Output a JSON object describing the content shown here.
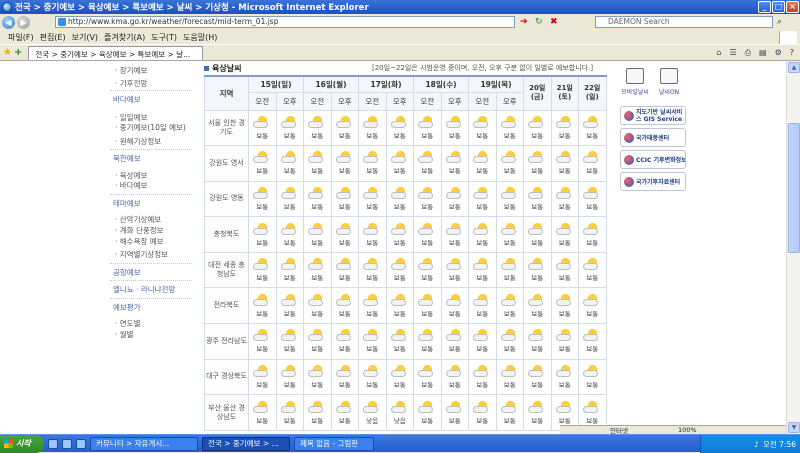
{
  "window": {
    "title": "전국 > 중기예보 > 육상예보 > 특보예보 > 날씨 > 기상청 - Microsoft Internet Explorer"
  },
  "browser": {
    "address": "http://www.kma.go.kr/weather/forecast/mid-term_01.jsp",
    "search_placeholder": "DAEMON Search",
    "menu": [
      "파일(F)",
      "편집(E)",
      "보기(V)",
      "즐겨찾기(A)",
      "도구(T)",
      "도움말(H)"
    ],
    "tab_title": "전국 > 중기예보 > 육상예보 > 특보예보 > 날..."
  },
  "leftnav": {
    "items": [
      {
        "label": "· 장기예보",
        "type": "sub"
      },
      {
        "label": "· 기후전망",
        "type": "sub"
      },
      {
        "label": "바다예보",
        "type": "cat"
      },
      {
        "label": "· 일일예보",
        "type": "sub"
      },
      {
        "label": "· 중기예보(10일 예보)",
        "type": "sub"
      },
      {
        "label": "· 원해기상정보",
        "type": "sub"
      },
      {
        "label": "북한예보",
        "type": "cat"
      },
      {
        "label": "· 육상예보",
        "type": "sub"
      },
      {
        "label": "· 바다예보",
        "type": "sub"
      },
      {
        "label": "테마예보",
        "type": "cat"
      },
      {
        "label": "· 산악기상예보",
        "type": "sub"
      },
      {
        "label": "· 계화 단풍정보",
        "type": "sub"
      },
      {
        "label": "· 해수욕장 예보",
        "type": "sub"
      },
      {
        "label": "· 지역별기상정보",
        "type": "sub"
      },
      {
        "label": "공항예보",
        "type": "cat"
      },
      {
        "label": "엘니뇨 · 라니냐전망",
        "type": "cat"
      },
      {
        "label": "예보평가",
        "type": "cat"
      },
      {
        "label": "· 연도별",
        "type": "sub"
      },
      {
        "label": "· 월별",
        "type": "sub"
      }
    ]
  },
  "forecast": {
    "heading": "육상날씨",
    "note": "[20일~22일은 시범운영 중이며, 오전, 오후 구분 없이 일별로 예보합니다.]",
    "region_header": "지역",
    "dates": [
      {
        "label": "15일(일)",
        "split": true
      },
      {
        "label": "16일(월)",
        "split": true
      },
      {
        "label": "17일(화)",
        "split": true
      },
      {
        "label": "18일(수)",
        "split": true
      },
      {
        "label": "19일(목)",
        "split": true
      },
      {
        "label": "20일 (금)",
        "split": false
      },
      {
        "label": "21일 (토)",
        "split": false
      },
      {
        "label": "22일 (일)",
        "split": false
      }
    ],
    "am": "오전",
    "pm": "오후",
    "regions": [
      {
        "name": "서울 인천 경기도",
        "w": [
          "보통",
          "보통",
          "보통",
          "보통",
          "보통",
          "보통",
          "보통",
          "보통",
          "보통",
          "보통",
          "보통",
          "보통",
          "보통"
        ]
      },
      {
        "name": "강원도 영서",
        "w": [
          "보통",
          "보통",
          "보통",
          "보통",
          "보통",
          "보통",
          "보통",
          "보통",
          "보통",
          "보통",
          "보통",
          "보통",
          "보통"
        ]
      },
      {
        "name": "강원도 영동",
        "w": [
          "보통",
          "보통",
          "보통",
          "보통",
          "보통",
          "보통",
          "보통",
          "보통",
          "보통",
          "보통",
          "보통",
          "보통",
          "보통"
        ]
      },
      {
        "name": "충청북도",
        "w": [
          "보통",
          "보통",
          "보통",
          "보통",
          "보통",
          "보통",
          "보통",
          "보통",
          "보통",
          "보통",
          "보통",
          "보통",
          "보통"
        ]
      },
      {
        "name": "대전 세종 충청남도",
        "w": [
          "보통",
          "보통",
          "보통",
          "보통",
          "보통",
          "보통",
          "보통",
          "보통",
          "보통",
          "보통",
          "보통",
          "보통",
          "보통"
        ]
      },
      {
        "name": "전라북도",
        "w": [
          "보통",
          "보통",
          "보통",
          "보통",
          "보통",
          "보통",
          "보통",
          "보통",
          "보통",
          "보통",
          "보통",
          "보통",
          "보통"
        ]
      },
      {
        "name": "광주 전라남도",
        "w": [
          "보통",
          "보통",
          "보통",
          "보통",
          "보통",
          "보통",
          "보통",
          "보통",
          "보통",
          "보통",
          "보통",
          "보통",
          "보통"
        ]
      },
      {
        "name": "대구 경상북도",
        "w": [
          "보통",
          "보통",
          "보통",
          "보통",
          "보통",
          "보통",
          "보통",
          "보통",
          "보통",
          "보통",
          "보통",
          "보통",
          "보통"
        ]
      },
      {
        "name": "부산 울산 경상남도",
        "w": [
          "보통",
          "보통",
          "보통",
          "보통",
          "낮음",
          "낮음",
          "보통",
          "보통",
          "보통",
          "보통",
          "보통",
          "보통",
          "보통"
        ]
      }
    ]
  },
  "rightside": {
    "icons": [
      {
        "label": "모바일날씨",
        "icon": "mobile-icon"
      },
      {
        "label": "날씨ON",
        "icon": "tv-icon"
      }
    ],
    "banners": [
      "지도기반 날씨서비스 GIS Service",
      "국가태풍센터",
      "CCIC 기후변화정보센터",
      "국가기후자료센터"
    ]
  },
  "statusbar": {
    "zone": "인터넷",
    "zoom": "100%"
  },
  "taskbar": {
    "start": "시작",
    "tasks": [
      "커뮤니티 > 자유게시...",
      "전국 > 중기예보 > ...",
      "제목 없음 - 그림판"
    ],
    "active_index": 1,
    "clock": "오전 7:56"
  }
}
